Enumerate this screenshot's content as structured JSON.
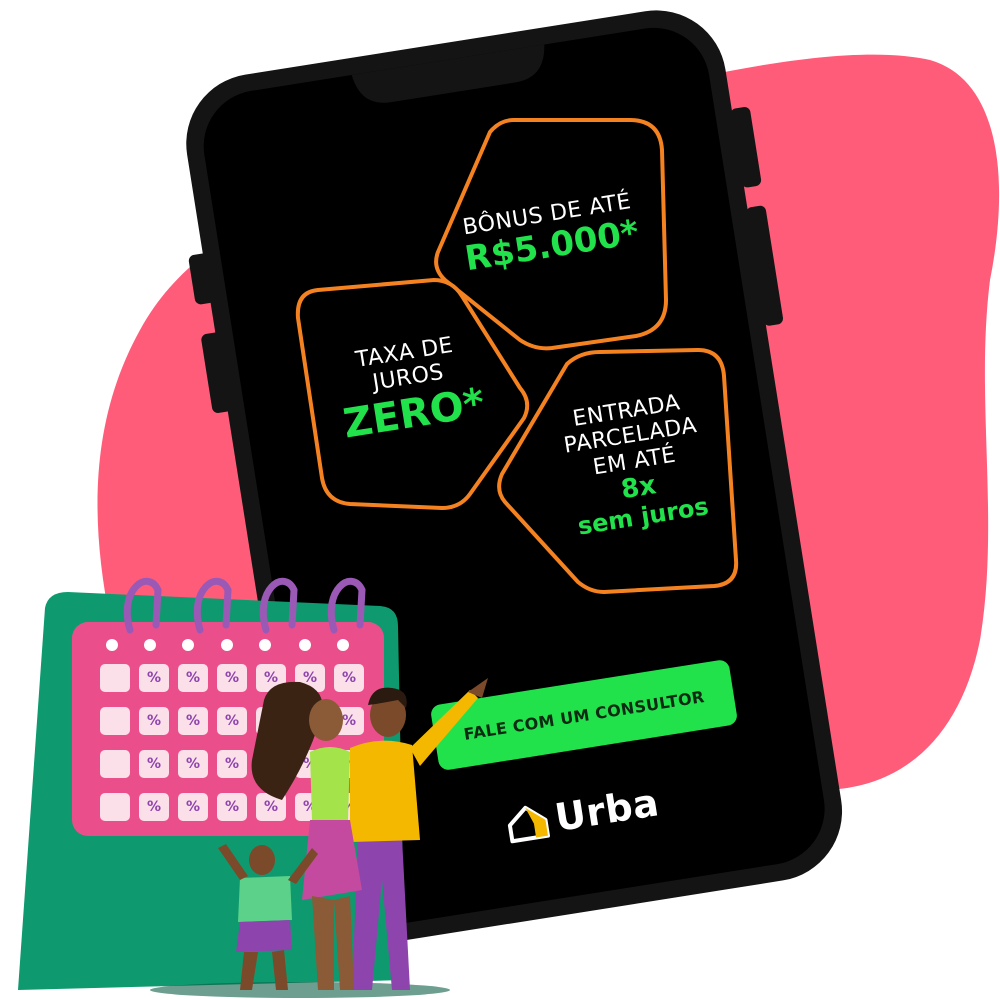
{
  "colors": {
    "background_blob": "#ff5c7a",
    "phone_body": "#141414",
    "box_border": "#f58220",
    "accent_green": "#22e24c",
    "calendar_green": "#0e9a6e",
    "calendar_pink": "#ea4f8c",
    "ring_purple": "#9b59b6"
  },
  "offers": {
    "bonus": {
      "label": "BÔNUS DE ATÉ",
      "highlight": "R$5.000*"
    },
    "juros": {
      "line1": "TAXA DE",
      "line2": "JUROS",
      "highlight": "ZERO*"
    },
    "entrada": {
      "line1": "ENTRADA",
      "line2": "PARCELADA",
      "line3": "EM ATÉ",
      "highlight1": "8x",
      "highlight2": "sem juros"
    }
  },
  "cta": {
    "label": "FALE COM UM CONSULTOR"
  },
  "brand": {
    "name": "Urba",
    "icon": "house-logo-icon"
  },
  "calendar": {
    "cell_symbol": "%",
    "rows": 4,
    "cols": 7,
    "icon": "calendar-icon"
  },
  "illustration": {
    "icon": "family-illustration"
  }
}
